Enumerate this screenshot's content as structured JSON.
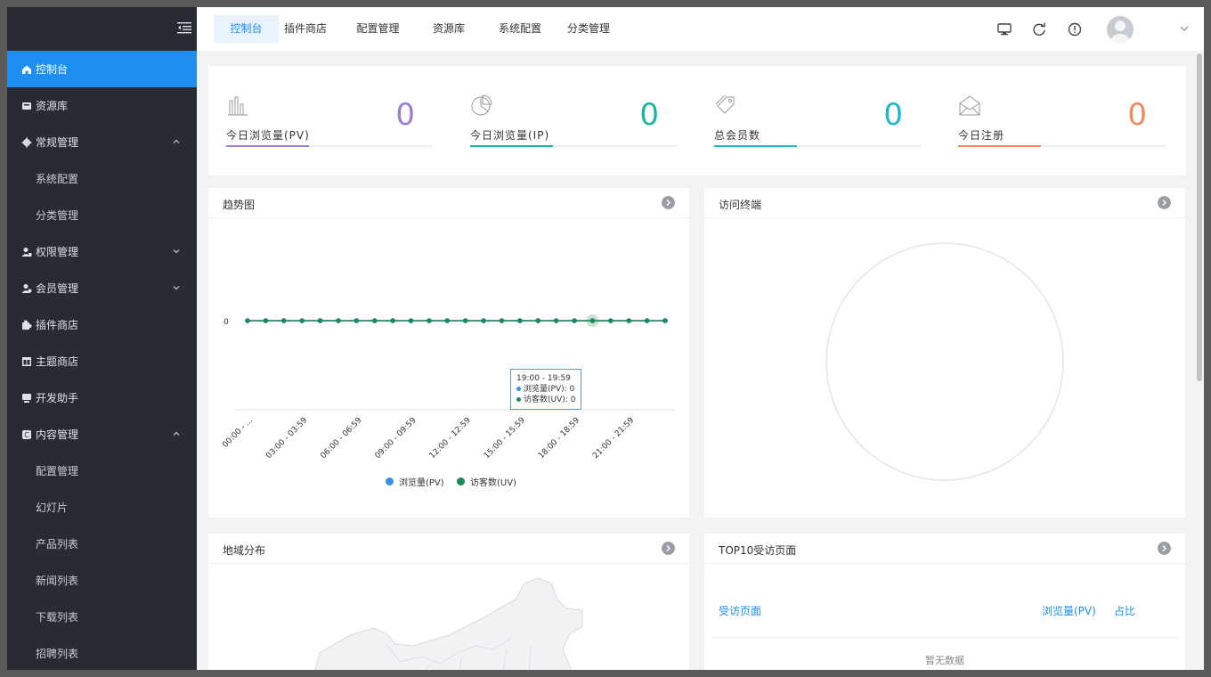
{
  "sidebar": {
    "items": [
      {
        "label": "控制台",
        "icon": "home-icon",
        "active": true,
        "arrow": ""
      },
      {
        "label": "资源库",
        "icon": "archive-icon",
        "arrow": ""
      },
      {
        "label": "常规管理",
        "icon": "gear-icon",
        "arrow": "up"
      },
      {
        "label": "系统配置",
        "sub": true
      },
      {
        "label": "分类管理",
        "sub": true
      },
      {
        "label": "权限管理",
        "icon": "user-permission-icon",
        "arrow": "down"
      },
      {
        "label": "会员管理",
        "icon": "member-icon",
        "arrow": "down"
      },
      {
        "label": "插件商店",
        "icon": "puzzle-icon",
        "arrow": ""
      },
      {
        "label": "主题商店",
        "icon": "layout-icon",
        "arrow": ""
      },
      {
        "label": "开发助手",
        "icon": "developer-icon",
        "arrow": ""
      },
      {
        "label": "内容管理",
        "icon": "content-icon",
        "arrow": "up"
      },
      {
        "label": "配置管理",
        "sub": true
      },
      {
        "label": "幻灯片",
        "sub": true
      },
      {
        "label": "产品列表",
        "sub": true
      },
      {
        "label": "新闻列表",
        "sub": true
      },
      {
        "label": "下载列表",
        "sub": true
      },
      {
        "label": "招聘列表",
        "sub": true
      }
    ]
  },
  "header": {
    "tabs": [
      {
        "label": "控制台",
        "active": true
      },
      {
        "label": "插件商店"
      },
      {
        "label": "配置管理"
      },
      {
        "label": "资源库"
      },
      {
        "label": "系统配置"
      },
      {
        "label": "分类管理"
      }
    ],
    "icons": [
      "monitor-icon",
      "refresh-icon",
      "alert-circle-icon"
    ]
  },
  "stats": [
    {
      "label": "今日浏览量(PV)",
      "value": "0",
      "color": "#9b7fd4",
      "icon": "bar-chart-icon",
      "fill": 0.4
    },
    {
      "label": "今日浏览量(IP)",
      "value": "0",
      "color": "#1fb5a1",
      "icon": "pie-chart-icon",
      "fill": 0.4
    },
    {
      "label": "总会员数",
      "value": "0",
      "color": "#20b7c9",
      "icon": "tags-icon",
      "fill": 0.4
    },
    {
      "label": "今日注册",
      "value": "0",
      "color": "#ef8a62",
      "icon": "mail-open-icon",
      "fill": 0.4
    }
  ],
  "panels": {
    "trend_title": "趋势图",
    "device_title": "访问终端",
    "region_title": "地域分布",
    "top10_title": "TOP10受访页面"
  },
  "chart_data": {
    "type": "line",
    "categories": [
      "00:00 - ...",
      "03:00 - 03:59",
      "06:00 - 06:59",
      "09:00 - 09:59",
      "12:00 - 12:59",
      "15:00 - 15:59",
      "18:00 - 18:59",
      "21:00 - 21:59"
    ],
    "points": 24,
    "y_tick": "0",
    "series": [
      {
        "name": "浏览量(PV)",
        "color": "#3a8ee6",
        "values": [
          0,
          0,
          0,
          0,
          0,
          0,
          0,
          0,
          0,
          0,
          0,
          0,
          0,
          0,
          0,
          0,
          0,
          0,
          0,
          0,
          0,
          0,
          0,
          0
        ]
      },
      {
        "name": "访客数(UV)",
        "color": "#1e8a4f",
        "values": [
          0,
          0,
          0,
          0,
          0,
          0,
          0,
          0,
          0,
          0,
          0,
          0,
          0,
          0,
          0,
          0,
          0,
          0,
          0,
          0,
          0,
          0,
          0,
          0
        ]
      }
    ],
    "tooltip": {
      "time": "19:00 - 19:59",
      "pv_label": "浏览量(PV):",
      "pv_value": "0",
      "uv_label": "访客数(UV):",
      "uv_value": "0"
    }
  },
  "top10": {
    "col_page": "受访页面",
    "col_pv": "浏览量(PV)",
    "col_ratio": "占比",
    "empty": "暂无数据"
  }
}
